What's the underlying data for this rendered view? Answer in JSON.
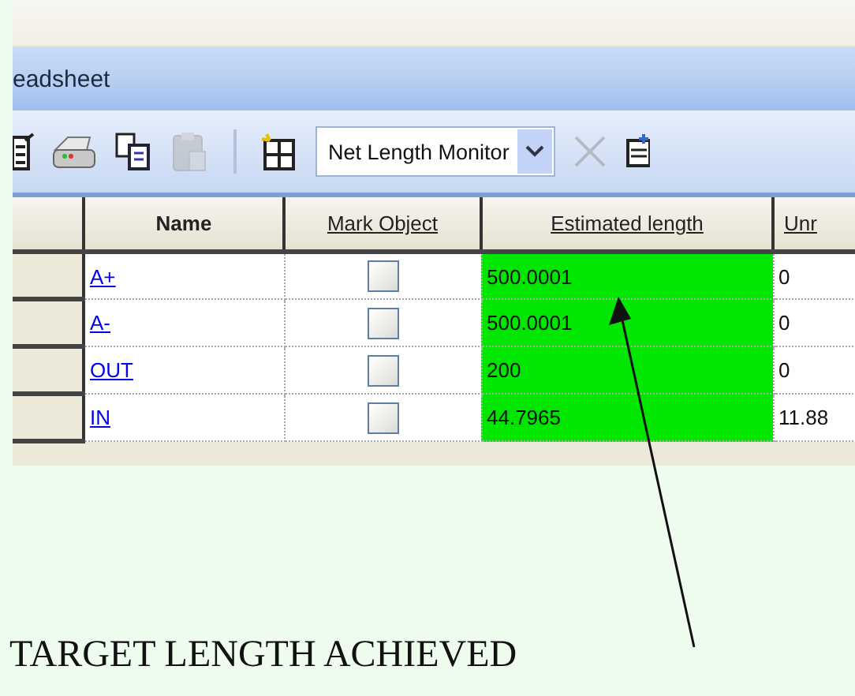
{
  "window": {
    "title": "eadsheet"
  },
  "toolbar": {
    "buttons": [
      {
        "disabled": false
      },
      {
        "disabled": false
      },
      {
        "disabled": false
      },
      {
        "disabled": true
      },
      {
        "disabled": false
      }
    ],
    "dropdown": {
      "value": "Net Length Monitor"
    },
    "trailing_buttons": [
      {
        "disabled": true
      },
      {
        "disabled": false
      }
    ]
  },
  "table": {
    "columns": [
      "Name",
      "Mark Object",
      "Estimated length",
      "Unr"
    ],
    "rows": [
      {
        "name": "A+",
        "mark_object": false,
        "estimated_length": "500.0001",
        "highlighted": true,
        "column_4": "0"
      },
      {
        "name": "A-",
        "mark_object": false,
        "estimated_length": "500.0001",
        "highlighted": true,
        "column_4": "0"
      },
      {
        "name": "OUT",
        "mark_object": false,
        "estimated_length": "200",
        "highlighted": true,
        "column_4": "0"
      },
      {
        "name": "IN",
        "mark_object": false,
        "estimated_length": "44.7965",
        "highlighted": true,
        "column_4": "11.88"
      }
    ]
  },
  "annotation": {
    "text": "TARGET LENGTH ACHIEVED"
  }
}
